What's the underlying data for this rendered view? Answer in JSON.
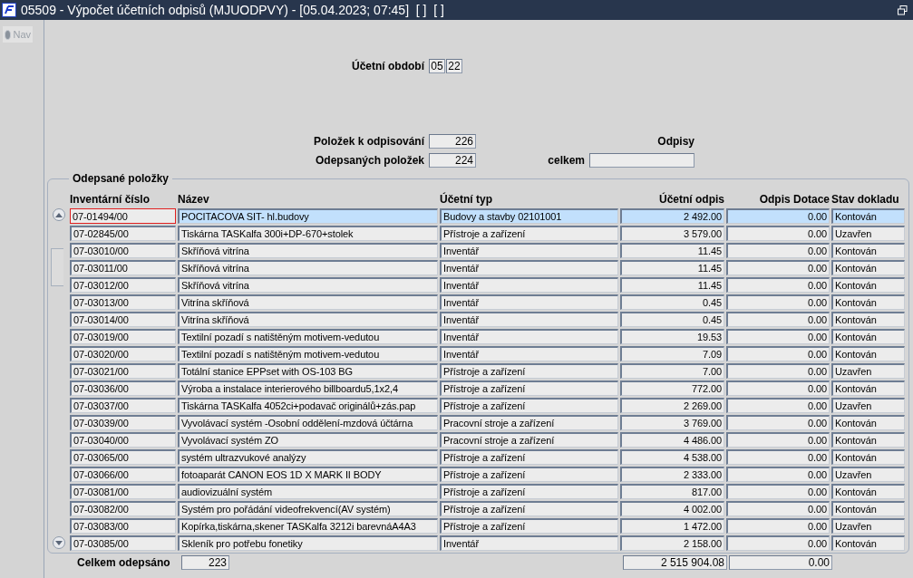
{
  "window": {
    "title": "05509 - Výpočet účetních odpisů (MJUODPVY) - [05.04.2023; 07:45]  [ ]  [ ]"
  },
  "nav": {
    "label": "Nav",
    "disabled": true
  },
  "period": {
    "label": "Účetní období",
    "month": "05",
    "year": "22"
  },
  "counts": {
    "to_write_off_label": "Položek k odpisování",
    "to_write_off": "226",
    "written_off_label": "Odepsaných položek",
    "written_off": "224"
  },
  "writeoffs": {
    "heading": "Odpisy",
    "total_label": "celkem"
  },
  "table": {
    "title": "Odepsané položky",
    "columns": [
      "Inventární číslo",
      "Název",
      "Účetní typ",
      "Účetní odpis",
      "Odpis Dotace",
      "Stav dokladu"
    ],
    "rows": [
      {
        "inv": "07-01494/00",
        "name": "POCITACOVA SIT- hl.budovy",
        "type": "Budovy a stavby 02101001",
        "amount": "2 492.00",
        "grant": "0.00",
        "status": "Kontován",
        "selected": true
      },
      {
        "inv": "07-02845/00",
        "name": "Tiskárna TASKalfa 300i+DP-670+stolek",
        "type": "Přístroje a zařízení",
        "amount": "3 579.00",
        "grant": "0.00",
        "status": "Uzavřen",
        "selected": false
      },
      {
        "inv": "07-03010/00",
        "name": "Skříňová vitrína",
        "type": "Inventář",
        "amount": "11.45",
        "grant": "0.00",
        "status": "Kontován",
        "selected": false
      },
      {
        "inv": "07-03011/00",
        "name": "Skříňová vitrína",
        "type": "Inventář",
        "amount": "11.45",
        "grant": "0.00",
        "status": "Kontován",
        "selected": false
      },
      {
        "inv": "07-03012/00",
        "name": "Skříňová vitrína",
        "type": "Inventář",
        "amount": "11.45",
        "grant": "0.00",
        "status": "Kontován",
        "selected": false
      },
      {
        "inv": "07-03013/00",
        "name": "Vitrína skříňová",
        "type": "Inventář",
        "amount": "0.45",
        "grant": "0.00",
        "status": "Kontován",
        "selected": false
      },
      {
        "inv": "07-03014/00",
        "name": "Vitrína skříňová",
        "type": "Inventář",
        "amount": "0.45",
        "grant": "0.00",
        "status": "Kontován",
        "selected": false
      },
      {
        "inv": "07-03019/00",
        "name": "Textilní pozadí s natištěným motivem-vedutou",
        "type": "Inventář",
        "amount": "19.53",
        "grant": "0.00",
        "status": "Kontován",
        "selected": false
      },
      {
        "inv": "07-03020/00",
        "name": "Textilní pozadí s natištěným motivem-vedutou",
        "type": "Inventář",
        "amount": "7.09",
        "grant": "0.00",
        "status": "Kontován",
        "selected": false
      },
      {
        "inv": "07-03021/00",
        "name": "Totální stanice EPPset with OS-103 BG",
        "type": "Přístroje a zařízení",
        "amount": "7.00",
        "grant": "0.00",
        "status": "Uzavřen",
        "selected": false
      },
      {
        "inv": "07-03036/00",
        "name": "Výroba a instalace interierového billboardu5,1x2,4",
        "type": "Přístroje a zařízení",
        "amount": "772.00",
        "grant": "0.00",
        "status": "Kontován",
        "selected": false
      },
      {
        "inv": "07-03037/00",
        "name": "Tiskárna TASKalfa 4052ci+podavač originálů+zás.pap",
        "type": "Přístroje a zařízení",
        "amount": "2 269.00",
        "grant": "0.00",
        "status": "Uzavřen",
        "selected": false
      },
      {
        "inv": "07-03039/00",
        "name": "Vyvolávací systém -Osobní oddělení-mzdová účtárna",
        "type": "Pracovní stroje a zařízení",
        "amount": "3 769.00",
        "grant": "0.00",
        "status": "Kontován",
        "selected": false
      },
      {
        "inv": "07-03040/00",
        "name": "Vyvolávací systém ZO",
        "type": "Pracovní stroje a zařízení",
        "amount": "4 486.00",
        "grant": "0.00",
        "status": "Kontován",
        "selected": false
      },
      {
        "inv": "07-03065/00",
        "name": "systém ultrazvukové analýzy",
        "type": "Přístroje a zařízení",
        "amount": "4 538.00",
        "grant": "0.00",
        "status": "Kontován",
        "selected": false
      },
      {
        "inv": "07-03066/00",
        "name": "fotoaparát CANON EOS 1D X MARK II BODY",
        "type": "Přístroje a zařízení",
        "amount": "2 333.00",
        "grant": "0.00",
        "status": "Uzavřen",
        "selected": false
      },
      {
        "inv": "07-03081/00",
        "name": "audiovizuální systém",
        "type": "Přístroje a zařízení",
        "amount": "817.00",
        "grant": "0.00",
        "status": "Kontován",
        "selected": false
      },
      {
        "inv": "07-03082/00",
        "name": "Systém pro pořádání videofrekvencí(AV systém)",
        "type": "Přístroje a zařízení",
        "amount": "4 002.00",
        "grant": "0.00",
        "status": "Kontován",
        "selected": false
      },
      {
        "inv": "07-03083/00",
        "name": "Kopírka,tiskárna,skener TASKalfa 3212i barevnáA4A3",
        "type": "Přístroje a zařízení",
        "amount": "1 472.00",
        "grant": "0.00",
        "status": "Uzavřen",
        "selected": false
      },
      {
        "inv": "07-03085/00",
        "name": "Skleník pro potřebu fonetiky",
        "type": "Inventář",
        "amount": "2 158.00",
        "grant": "0.00",
        "status": "Kontován",
        "selected": false
      }
    ],
    "footer": {
      "label": "Celkem odepsáno",
      "count": "223",
      "amount_total": "2 515 904.08",
      "grant_total": "0.00"
    }
  }
}
